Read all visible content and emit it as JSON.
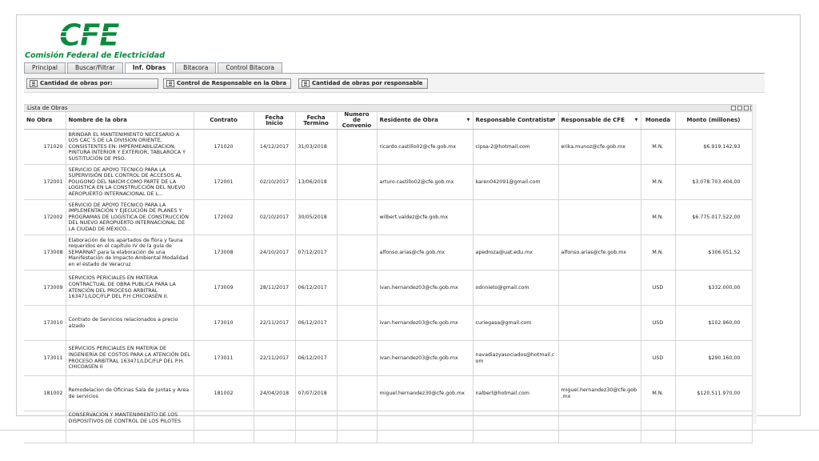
{
  "brand": {
    "name": "Comisión Federal de Electricidad",
    "colors": {
      "green": "#0a8a3e"
    }
  },
  "tabs": [
    {
      "label": "Principal"
    },
    {
      "label": "Buscar/Filtrar"
    },
    {
      "label": "Inf. Obras"
    },
    {
      "label": "Bitacora"
    },
    {
      "label": "Control Bitacora"
    }
  ],
  "toolbar": {
    "btn_cantidad_obras": "Cantidad de obras por:",
    "btn_control_responsable": "Control de Responsable en la Obra",
    "btn_cantidad_responsable": "Cantidad de obras por responsable"
  },
  "panel": {
    "title": "Lista de Obras"
  },
  "table": {
    "headers": {
      "no_obra": "No Obra",
      "nombre": "Nombre de la obra",
      "contrato": "Contrato",
      "fecha_inicio": "Fecha Inicio",
      "fecha_termino": "Fecha Termino",
      "numero_convenio": "Numero de Convenio",
      "residente": "Residente de Obra",
      "resp_contratista": "Responsable Contratista",
      "resp_cfe": "Responsable de CFE",
      "moneda": "Moneda",
      "monto": "Monto (millones)"
    },
    "rows": [
      {
        "no": "171020",
        "nombre": "BRINDAR EL MANTENIMIENTO NECESARIO A LOS CAC´S DE LA DIVISION ORIENTE, CONSISTENTES EN: IMPERMEABILIZACION, PINTURA INTERIOR Y EXTERIOR, TABLAROCA Y SUSTITUCIÓN DE PISO.",
        "contrato": "171020",
        "inicio": "14/12/2017",
        "termino": "31/03/2018",
        "convenio": "",
        "residente": "ricardo.castillo02@cfe.gob.mx",
        "contratista": "cipsa-2@hotmail.com",
        "cfe": "erika.munoz@cfe.gob.mx",
        "moneda": "M.N.",
        "monto": "$6.919.142,93"
      },
      {
        "no": "172001",
        "nombre": "SERVICIO DE APOYO TECNICO PARA LA SUPERVISIÓN DEL CONTROL DE ACCESOS AL POLIGONO DEL NAICM COMO PARTE DE LA LOGISTICA EN LA CONSTRUCCIÓN DEL NUEVO AEROPUERTO INTERNACIONAL DE L...",
        "contrato": "172001",
        "inicio": "02/10/2017",
        "termino": "13/06/2018",
        "convenio": "",
        "residente": "arturo.castillo02@cfe.gob.mx",
        "contratista": "karen042091@gmail.com",
        "cfe": "",
        "moneda": "M.N.",
        "monto": "$3.078.703.404,00"
      },
      {
        "no": "172002",
        "nombre": "SERVICIO DE APOYO TÉCNICO PARA LA IMPLEMENTACIÓN Y EJECUCIÓN DE PLANES Y PROGRAMAS DE LOGÍSTICA DE CONSTRUCCIÓN DEL NUEVO AEROPUERTO INTERNACIONAL DE LA CIUDAD DE MÉXICO...",
        "contrato": "172002",
        "inicio": "02/10/2017",
        "termino": "30/05/2018",
        "convenio": "",
        "residente": "wilbert.valdez@cfe.gob.mx",
        "contratista": "",
        "cfe": "",
        "moneda": "M.N.",
        "monto": "$6.775.017.522,00"
      },
      {
        "no": "173008",
        "nombre": "Elaboración de los apartados de flora y fauna requeridos en el capítulo IV de la guía de SEMARNAT para la elaboración de una Manifestación de Impacto Ambiental Modalidad en el estado de Veracruz",
        "contrato": "173008",
        "inicio": "24/10/2017",
        "termino": "07/12/2017",
        "convenio": "",
        "residente": "alfonso.arias@cfe.gob.mx",
        "contratista": "apedroza@uat.edu.mx",
        "cfe": "alfonso.arias@cfe.gob.mx",
        "moneda": "M.N.",
        "monto": "$306.051,52"
      },
      {
        "no": "173009",
        "nombre": "SERVICIOS PERICIALES EN MATERIA CONTRACTUAL DE OBRA PUBLICA PARA LA ATENCIÓN DEL PROCESO ARBITRAL 163471/LDC/FLP DEL P.H CHICOASÉN II.",
        "contrato": "173009",
        "inicio": "28/11/2017",
        "termino": "06/12/2017",
        "convenio": "",
        "residente": "ivan.hernandez03@cfe.gob.mx",
        "contratista": "odnnieto@gmail.com",
        "cfe": "",
        "moneda": "USD",
        "monto": "$332.000,00"
      },
      {
        "no": "173010",
        "nombre": "Contrato de Servicios relacionados a precio alzado",
        "contrato": "173010",
        "inicio": "22/11/2017",
        "termino": "06/12/2017",
        "convenio": "",
        "residente": "ivan.hernandez03@cfe.gob.mx",
        "contratista": "curiegasa@gmail.com",
        "cfe": "",
        "moneda": "USD",
        "monto": "$102.960,00"
      },
      {
        "no": "173011",
        "nombre": "SERVICIOS PERICIALES EN MATERIA DE INGENIERÍA DE COSTOS PARA LA ATENCIÓN DEL PROCESO ARBITRAL 163471/LDC/FLP DEL P.H. CHICOASÉN II",
        "contrato": "173011",
        "inicio": "22/11/2017",
        "termino": "06/12/2017",
        "convenio": "",
        "residente": "ivan.hernandez03@cfe.gob.mx",
        "contratista": "navadiazyasociados@hotmail.com",
        "cfe": "",
        "moneda": "USD",
        "monto": "$290.160,00"
      },
      {
        "no": "181002",
        "nombre": "Remodelacion de Oficinas Sala de Juntas y Area de servicios",
        "contrato": "181002",
        "inicio": "24/04/2018",
        "termino": "07/07/2018",
        "convenio": "",
        "residente": "miguel.hernandez30@cfe.gob.mx",
        "contratista": "nalberl@hotmail.com",
        "cfe": "miguel.hernandez30@cfe.gob.mx",
        "moneda": "M.N.",
        "monto": "$120.511.970,00"
      },
      {
        "no": "",
        "nombre": "CONSERVACIÓN Y MANTENIMIENTO DE LOS DISPOSITIVOS DE CONTROL DE LOS PILOTES",
        "contrato": "",
        "inicio": "",
        "termino": "",
        "convenio": "",
        "residente": "",
        "contratista": "",
        "cfe": "",
        "moneda": "",
        "monto": ""
      }
    ]
  }
}
